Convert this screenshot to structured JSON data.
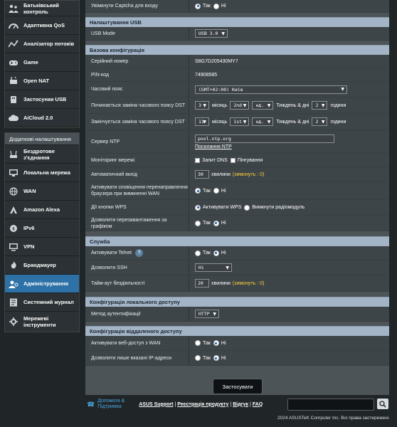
{
  "sidebar": {
    "group1": [
      {
        "label": "Батьківський контроль",
        "icon": "parental-control-icon"
      },
      {
        "label": "Адаптивна QoS",
        "icon": "qos-icon"
      },
      {
        "label": "Аналізатор потоків",
        "icon": "traffic-analyzer-icon"
      },
      {
        "label": "Game",
        "icon": "game-icon"
      },
      {
        "label": "Open NAT",
        "icon": "open-nat-icon"
      },
      {
        "label": "Застосунки USB",
        "icon": "usb-icon"
      },
      {
        "label": "AiCloud 2.0",
        "icon": "cloud-icon"
      }
    ],
    "advanced_header": "Додаткові налаштування",
    "group2": [
      {
        "label": "Бездротове з'єднання",
        "icon": "wireless-icon"
      },
      {
        "label": "Локальна мережа",
        "icon": "lan-icon"
      },
      {
        "label": "WAN",
        "icon": "wan-icon"
      },
      {
        "label": "Amazon Alexa",
        "icon": "alexa-icon"
      },
      {
        "label": "IPv6",
        "icon": "ipv6-icon"
      },
      {
        "label": "VPN",
        "icon": "vpn-icon"
      },
      {
        "label": "Брандмауер",
        "icon": "firewall-icon"
      },
      {
        "label": "Адміністрування",
        "icon": "administration-icon"
      },
      {
        "label": "Системний журнал",
        "icon": "system-log-icon"
      },
      {
        "label": "Мережеві інструменти",
        "icon": "network-tools-icon"
      }
    ]
  },
  "common": {
    "yes": "Так",
    "no": "Ні"
  },
  "captcha": {
    "label": "Увімкнути Captcha для входу"
  },
  "usb": {
    "title": "Налаштування USB",
    "mode_label": "USB Mode",
    "mode_value": "USB 3.0"
  },
  "basic": {
    "title": "Базова конфігурація",
    "serial_label": "Серійний номер",
    "serial_value": "S8G7D205430MY7",
    "pin_label": "PIN-код",
    "pin_value": "74908585",
    "tz_label": "Часовий пояс",
    "tz_value": "(GMT+02:00) Київ",
    "dst_start_label": "Починається заміна часового поясу DST",
    "dst_end_label": "Закінчується заміна часового поясу DST",
    "dst_start": {
      "month": "3",
      "week": "2nd",
      "day": "нд.",
      "hour": "2"
    },
    "dst_end": {
      "month": "11",
      "week": "1st",
      "day": "нд.",
      "hour": "2"
    },
    "month_word": "місяць",
    "week_day_word": "Тиждень & дні",
    "hours_word": "години",
    "ntp_label": "Сервер NTP",
    "ntp_value": "pool.ntp.org",
    "ntp_link": "Посилання NTP",
    "monitor_label": "Моніторинг мережі",
    "monitor_dns": "Запит DNS",
    "monitor_ping": "Пінгування",
    "autologout_label": "Автоматичний вихід",
    "autologout_value": "30",
    "minutes": "хвилини",
    "default0": "(зимонуть : 0)",
    "redirect_label": "Активувати сповіщення перенаправлення браузера при вимкненні WAN",
    "wps_label": "Дії кнопки WPS",
    "wps_opt1": "Активувати WPS",
    "wps_opt2": "Вимкнути радіомодуль",
    "reboot_label": "Дозволити перезавантаження за графіком"
  },
  "service": {
    "title": "Служба",
    "telnet_label": "Активувати Telnet",
    "help_icon": "?",
    "ssh_label": "Дозволити SSH",
    "ssh_value": "Ні",
    "idle_label": "Тайм-аут бездіяльності",
    "idle_value": "20",
    "minutes": "хвилини",
    "default0": "(зимонуть : 0)"
  },
  "local": {
    "title": "Конфігурація локального доступу",
    "auth_label": "Метод аутентифікації",
    "auth_value": "HTTP"
  },
  "remote": {
    "title": "Конфігурація віддаленого доступу",
    "web_label": "Активувати веб-доступ з WAN",
    "ip_label": "Дозволити лише вказані IP-адреси"
  },
  "apply_label": "Застосувати",
  "footer": {
    "help": "Допомога & Підтримка",
    "asus_support": "ASUS Support",
    "register": "Реєстрація продукту",
    "feedback": "Відгук",
    "faq": "FAQ",
    "sep": "|",
    "copyright": "2024 ASUSTeK Computer Inc. Всі права застережені."
  }
}
